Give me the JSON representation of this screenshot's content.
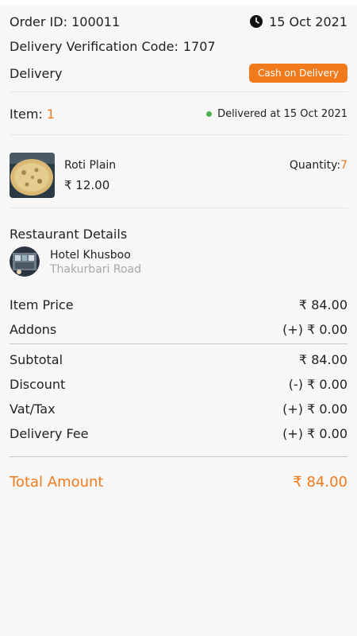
{
  "order": {
    "id_label": "Order ID:",
    "id_value": "100011",
    "date": "15 Oct 2021",
    "verification_label": "Delivery Verification Code:",
    "verification_value": "1707",
    "type": "Delivery",
    "payment_badge": "Cash on Delivery"
  },
  "items_summary": {
    "label": "Item:",
    "count": "1",
    "status": "Delivered at 15 Oct 2021"
  },
  "item": {
    "name": "Roti Plain",
    "price": "₹ 12.00",
    "quantity_label": "Quantity:",
    "quantity_value": "7"
  },
  "restaurant": {
    "section_title": "Restaurant Details",
    "name": "Hotel Khusboo",
    "address": "Thakurbari Road"
  },
  "price": {
    "item_price_label": "Item Price",
    "item_price_value": "₹ 84.00",
    "addons_label": "Addons",
    "addons_value": "(+) ₹ 0.00",
    "subtotal_label": "Subtotal",
    "subtotal_value": "₹ 84.00",
    "discount_label": "Discount",
    "discount_value": "(-) ₹ 0.00",
    "vat_label": "Vat/Tax",
    "vat_value": "(+) ₹ 0.00",
    "delivery_fee_label": "Delivery Fee",
    "delivery_fee_value": "(+) ₹ 0.00",
    "total_label": "Total Amount",
    "total_value": "₹ 84.00"
  },
  "icons": {
    "clock": "clock-icon",
    "status_dot": "status-dot-icon"
  },
  "colors": {
    "accent": "#f07a1c",
    "status_green": "#4caf50",
    "background": "#f7f7f7"
  }
}
